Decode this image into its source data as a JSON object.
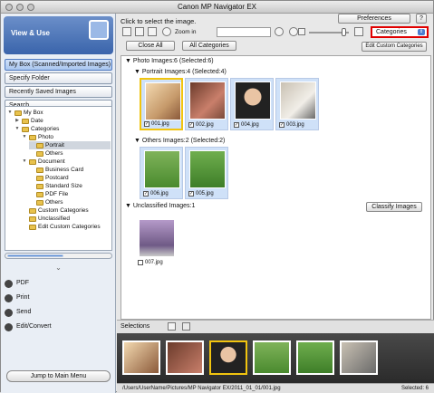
{
  "window": {
    "title": "Canon MP Navigator EX"
  },
  "left": {
    "header": "View & Use",
    "nav": [
      "My Box (Scanned/Imported Images)",
      "Specify Folder",
      "Recently Saved Images",
      "Search"
    ],
    "tree": [
      {
        "label": "My Box",
        "level": 0,
        "expanded": true
      },
      {
        "label": "Date",
        "level": 1,
        "expanded": false
      },
      {
        "label": "Categories",
        "level": 1,
        "expanded": true
      },
      {
        "label": "Photo",
        "level": 2,
        "expanded": true
      },
      {
        "label": "Portrait",
        "level": 3,
        "selected": true
      },
      {
        "label": "Others",
        "level": 3
      },
      {
        "label": "Document",
        "level": 2,
        "expanded": true
      },
      {
        "label": "Business Card",
        "level": 3
      },
      {
        "label": "Postcard",
        "level": 3
      },
      {
        "label": "Standard Size",
        "level": 3
      },
      {
        "label": "PDF File",
        "level": 3
      },
      {
        "label": "Others",
        "level": 3
      },
      {
        "label": "Custom Categories",
        "level": 2
      },
      {
        "label": "Unclassified",
        "level": 2
      },
      {
        "label": "Edit Custom Categories",
        "level": 2
      }
    ],
    "actions": [
      "PDF",
      "Print",
      "Send",
      "Edit/Convert"
    ],
    "jump_label": "Jump to Main Menu"
  },
  "right": {
    "hint": "Click to select the image.",
    "preferences": "Preferences",
    "help": "?",
    "zoom_label": "Zoom in",
    "category_select": "Categories",
    "close_all": "Close All",
    "all_categories": "All Categories",
    "edit_custom": "Edit Custom Categories",
    "photo_header": "Photo   Images:6  (Selected:6)",
    "portrait_header": "Portrait   Images:4  (Selected:4)",
    "others_header": "Others   Images:2  (Selected:2)",
    "unclassified_header": "Unclassified   Images:1",
    "classify_button": "Classify Images",
    "portrait_files": [
      "001.jpg",
      "002.jpg",
      "004.jpg",
      "003.jpg"
    ],
    "others_files": [
      "006.jpg",
      "005.jpg"
    ],
    "unclassified_files": [
      "007.jpg"
    ],
    "selections_label": "Selections",
    "status_path": "/Users/UserName/Pictures/MP Navigator EX/2011_01_01/001.jpg",
    "status_count": "Selected: 6"
  },
  "colors": {
    "accent": "#3a64ab",
    "highlight": "#e00000"
  }
}
